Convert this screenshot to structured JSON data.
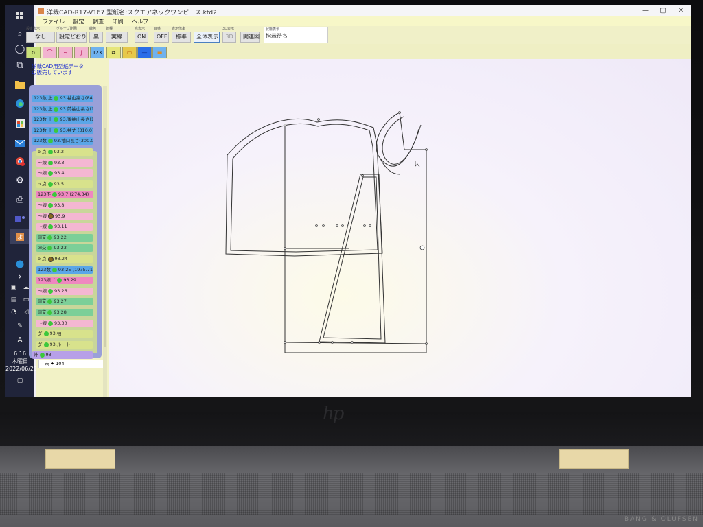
{
  "app": {
    "title": "洋裁CAD-R17-V167 型紙名:スクエアネックワンピース.ktd2",
    "window_controls": {
      "minimize": "—",
      "maximize": "▢",
      "close": "✕"
    }
  },
  "menu": [
    "ファイル",
    "設定",
    "調査",
    "印刷",
    "ヘルプ"
  ],
  "toolbar": [
    {
      "label": "設定表示",
      "value": "なし"
    },
    {
      "label": "グループ範囲",
      "value": "設定どおり"
    },
    {
      "label": "線色",
      "value": "黒"
    },
    {
      "label": "線種",
      "value": "実線"
    },
    {
      "label": "点表示",
      "value": "ON"
    },
    {
      "label": "目盛",
      "value": "OFF"
    },
    {
      "label": "表示倍率",
      "value": "標準"
    },
    {
      "label": "",
      "value": "全体表示"
    },
    {
      "label": "3D表示",
      "value": "3D"
    },
    {
      "label": "",
      "value": "関連図"
    }
  ],
  "status": {
    "label": "状態表示",
    "value": "指示待ち"
  },
  "tools": [
    "o",
    "⌒",
    "∼",
    "∫",
    "123",
    "⧉",
    "▭",
    "—",
    "▬"
  ],
  "panel_link": [
    "洋裁CAD用型紙データ",
    "の販売しています"
  ],
  "tree": [
    {
      "kind": "123数 上",
      "label": "93.袖山高さ(84...",
      "color": "num"
    },
    {
      "kind": "123数 上",
      "label": "93.前袖山長さ(1...",
      "color": "num"
    },
    {
      "kind": "123数 上",
      "label": "93.後袖山長さ(1...",
      "color": "num"
    },
    {
      "kind": "123数 上",
      "label": "93.袖丈 (310.0)",
      "color": "num"
    },
    {
      "kind": "123数",
      "label": "93.袖口長さ(300.0)",
      "color": "num"
    },
    {
      "kind": "o 点",
      "label": "93.2",
      "color": "pt"
    },
    {
      "kind": "〜線",
      "label": "93.3",
      "color": "line"
    },
    {
      "kind": "〜線",
      "label": "93.4",
      "color": "line"
    },
    {
      "kind": "o 点",
      "label": "93.5",
      "color": "pt"
    },
    {
      "kind": "123不",
      "label": "93.7 (274.34)",
      "color": "inv"
    },
    {
      "kind": "〜線",
      "label": "93.8",
      "color": "line"
    },
    {
      "kind": "〜線",
      "label": "93.9",
      "color": "line",
      "ring": true
    },
    {
      "kind": "〜線",
      "label": "93.11",
      "color": "line"
    },
    {
      "kind": "☒交",
      "label": "93.22",
      "color": "cross"
    },
    {
      "kind": "☒交",
      "label": "93.23",
      "color": "cross"
    },
    {
      "kind": "o 点",
      "label": "93.24",
      "color": "pt",
      "ring": true
    },
    {
      "kind": "123数",
      "label": "93.25 (1975.71)",
      "color": "num"
    },
    {
      "kind": "123線 ↑",
      "label": "93.29",
      "color": "inv"
    },
    {
      "kind": "〜線",
      "label": "93.26",
      "color": "line"
    },
    {
      "kind": "☒交",
      "label": "93.27",
      "color": "cross"
    },
    {
      "kind": "☒交",
      "label": "93.28",
      "color": "cross"
    },
    {
      "kind": "〜線",
      "label": "93.30",
      "color": "line"
    },
    {
      "kind": "グ",
      "label": "93.袖",
      "color": "grp"
    },
    {
      "kind": "グ",
      "label": "93.ルート",
      "color": "grp"
    },
    {
      "kind": "外",
      "label": "93",
      "color": "ext"
    }
  ],
  "extra_row": {
    "kind": "未",
    "label": "104"
  },
  "clock": {
    "time": "6:16",
    "day": "木曜日",
    "date": "2022/06/23"
  },
  "taskbar_icons": [
    "windows-icon",
    "search-icon",
    "cortana-icon",
    "taskview-icon",
    "explorer-icon",
    "edge-icon",
    "store-icon",
    "mail-icon",
    "chrome-icon",
    "settings-icon",
    "printer-icon",
    "teams-icon",
    "yosai-cad-icon"
  ],
  "device": {
    "brand": "hp",
    "speaker_text": "BANG & OLUFSEN"
  },
  "colors": {
    "taskbar": "#20243a",
    "panel": "#f2f2c6",
    "canvas": "#f6f2fb",
    "tree_outer": "#9aa0d8"
  }
}
